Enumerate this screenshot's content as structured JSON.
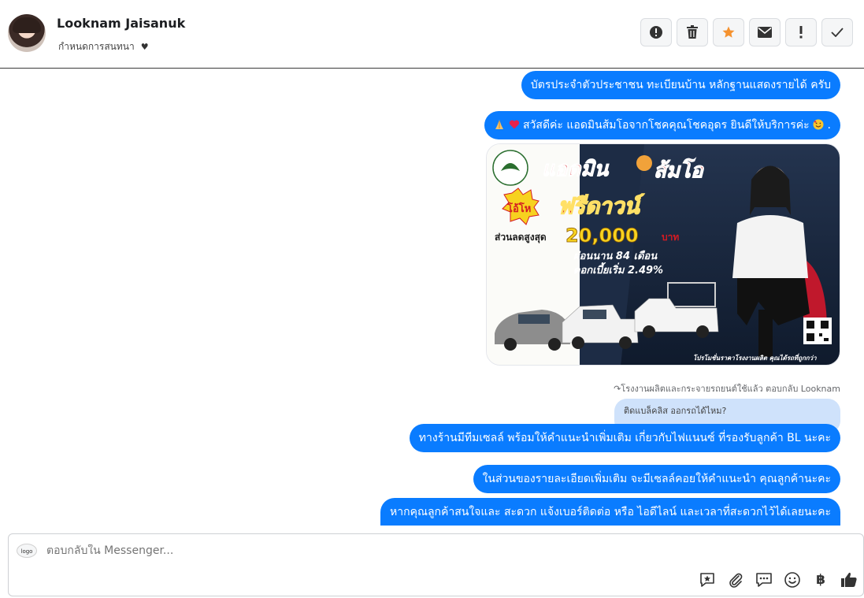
{
  "header": {
    "contact_name": "Looknam Jaisanuk",
    "subtitle": "กำหนดการสนทนา",
    "actions": [
      {
        "name": "alert-icon",
        "label": "!"
      },
      {
        "name": "trash-icon",
        "label": ""
      },
      {
        "name": "star-icon",
        "label": ""
      },
      {
        "name": "mail-icon",
        "label": ""
      },
      {
        "name": "exclamation-icon",
        "label": "!"
      },
      {
        "name": "check-icon",
        "label": ""
      }
    ],
    "star_color": "#f5922f"
  },
  "messages": [
    {
      "text": "บัตรประจำตัวประชาชน ทะเบียนบ้าน หลักฐานแสดงรายได้ ครับ"
    },
    {
      "text": "สวัสดีค่ะ แอดมินส้มโอจากโชคคุณโชคอุดร ยินดีให้บริการค่ะ",
      "suffix": "."
    },
    {
      "text": "ทางร้านมีทีมเซลล์ พร้อมให้คำแนะนำเพิ่มเติม เกี่ยวกับไฟแนนซ์ ที่รองรับลูกค้า BL นะคะ"
    },
    {
      "text": "ในส่วนของรายละเอียดเพิ่มเติม จะมีเซลล์คอยให้คำแนะนำ คุณลูกค้านะคะ"
    },
    {
      "text": "หากคุณลูกค้าสนใจและ สะดวก แจ้งเบอร์ติดต่อ หรือ ไอดีไลน์ และเวลาที่สะดวกไว้ได้เลยนะคะ"
    }
  ],
  "promo": {
    "headline": "แอดมิน",
    "headline2": "ส้มโอ",
    "badge": "โอ้โห",
    "free_down": "ฟรีดาวน์",
    "discount_label": "ส่วนลดสูงสุด",
    "discount_amount": "20,000",
    "discount_unit": "บาท",
    "installment": "ผ่อนนาน 84 เดือน",
    "interest": "ดอกเบี้ยเริ่ม 2.49%",
    "footer": "โปรโมชั่นราคาโรงงานผลิต คุณได้รถที่ถูกกว่า"
  },
  "reply": {
    "meta": "โรงงานผลิตและกระจายรถยนต์ใช้แล้ว ตอบกลับ Looknam",
    "quote": "ติดแบล็คลิส ออกรถได้ไหม?"
  },
  "composer": {
    "placeholder": "ตอบกลับใน Messenger...",
    "page_avatar_text": "logo"
  },
  "colors": {
    "bubble": "#0a7cff",
    "quote_bg": "#cfe2fb",
    "like": "#333333"
  }
}
